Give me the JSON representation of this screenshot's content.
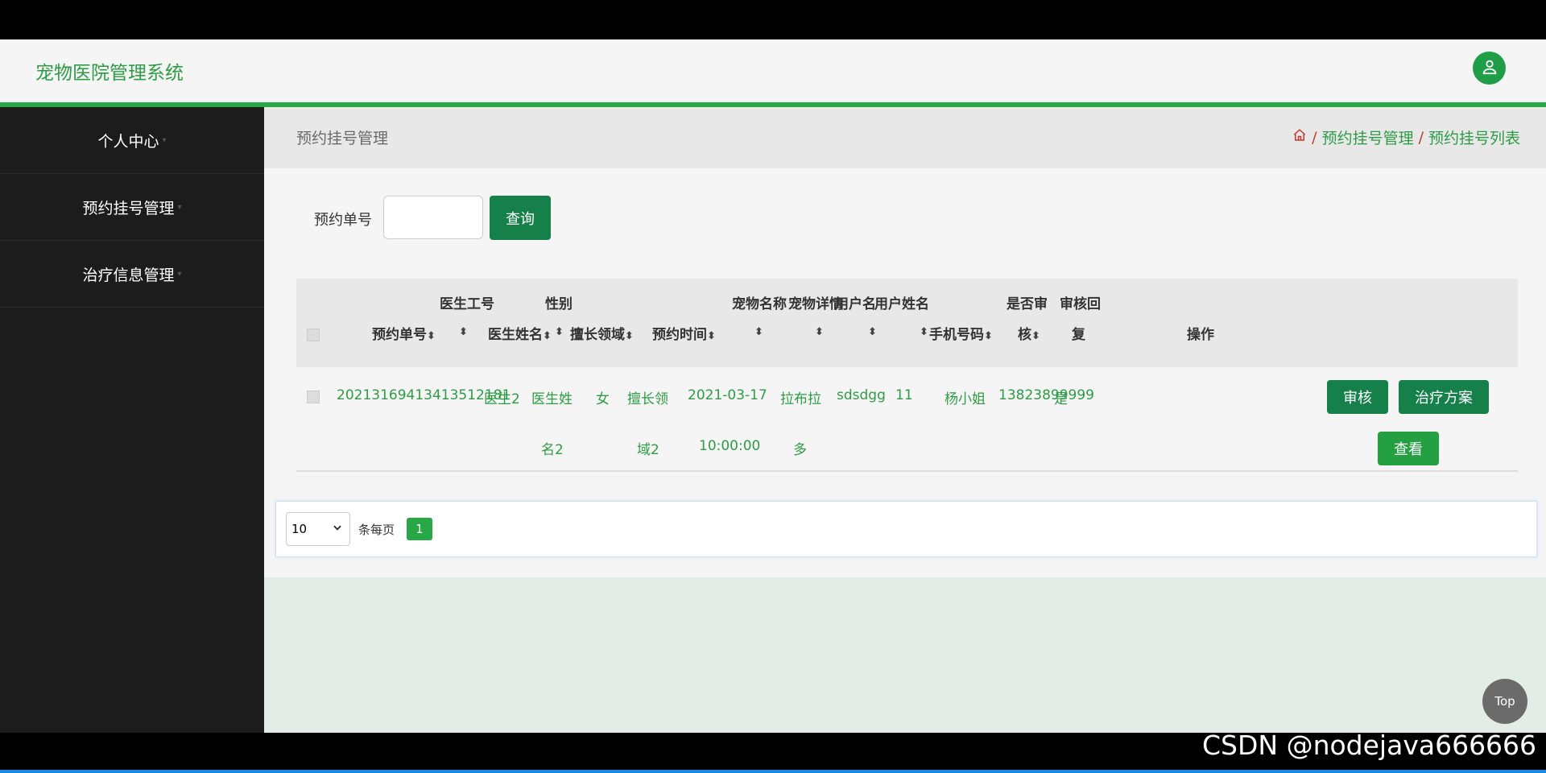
{
  "app": {
    "title": "宠物医院管理系统"
  },
  "sidebar": {
    "items": [
      {
        "label": "个人中心"
      },
      {
        "label": "预约挂号管理"
      },
      {
        "label": "治疗信息管理"
      }
    ]
  },
  "page": {
    "title": "预约挂号管理",
    "breadcrumb": [
      "预约挂号管理",
      "预约挂号列表"
    ]
  },
  "search": {
    "label": "预约单号",
    "button": "查询"
  },
  "table": {
    "headers": {
      "booking_no": "预约单号",
      "doctor_id": "医生工号",
      "doctor_name": "医生姓名",
      "gender": "性别",
      "specialty": "擅长领域",
      "booking_time": "预约时间",
      "pet_name": "宠物名称",
      "pet_detail": "宠物详情",
      "username": "用户名",
      "user_fullname": "用户姓名",
      "phone": "手机号码",
      "reviewed_1": "是否审",
      "reviewed_2": "核",
      "reply_1": "审核回",
      "reply_2": "复",
      "actions": "操作"
    },
    "rows": [
      {
        "booking_no": "20213169413413512181",
        "doctor_id": "医生2",
        "doctor_name_1": "医生姓",
        "doctor_name_2": "名2",
        "gender": "女",
        "specialty_1": "擅长领",
        "specialty_2": "域2",
        "time_1": "2021-03-17",
        "time_2": "10:00:00",
        "pet_name_1": "拉布拉",
        "pet_name_2": "多",
        "pet_detail": "sdsdgg",
        "username": "11",
        "user_fullname": "杨小姐",
        "phone": "13823899999",
        "reviewed": "是",
        "reply": "",
        "actions": {
          "review": "审核",
          "treatment": "治疗方案",
          "view": "查看"
        }
      }
    ]
  },
  "pagination": {
    "page_size": "10",
    "per_page_label": "条每页",
    "current_page": "1"
  },
  "top_button": "Top",
  "watermark": "CSDN @nodejava666666",
  "colors": {
    "accent": "#28a745",
    "sidebar_bg": "#1c1c1c",
    "link_green": "#2e9b45"
  }
}
